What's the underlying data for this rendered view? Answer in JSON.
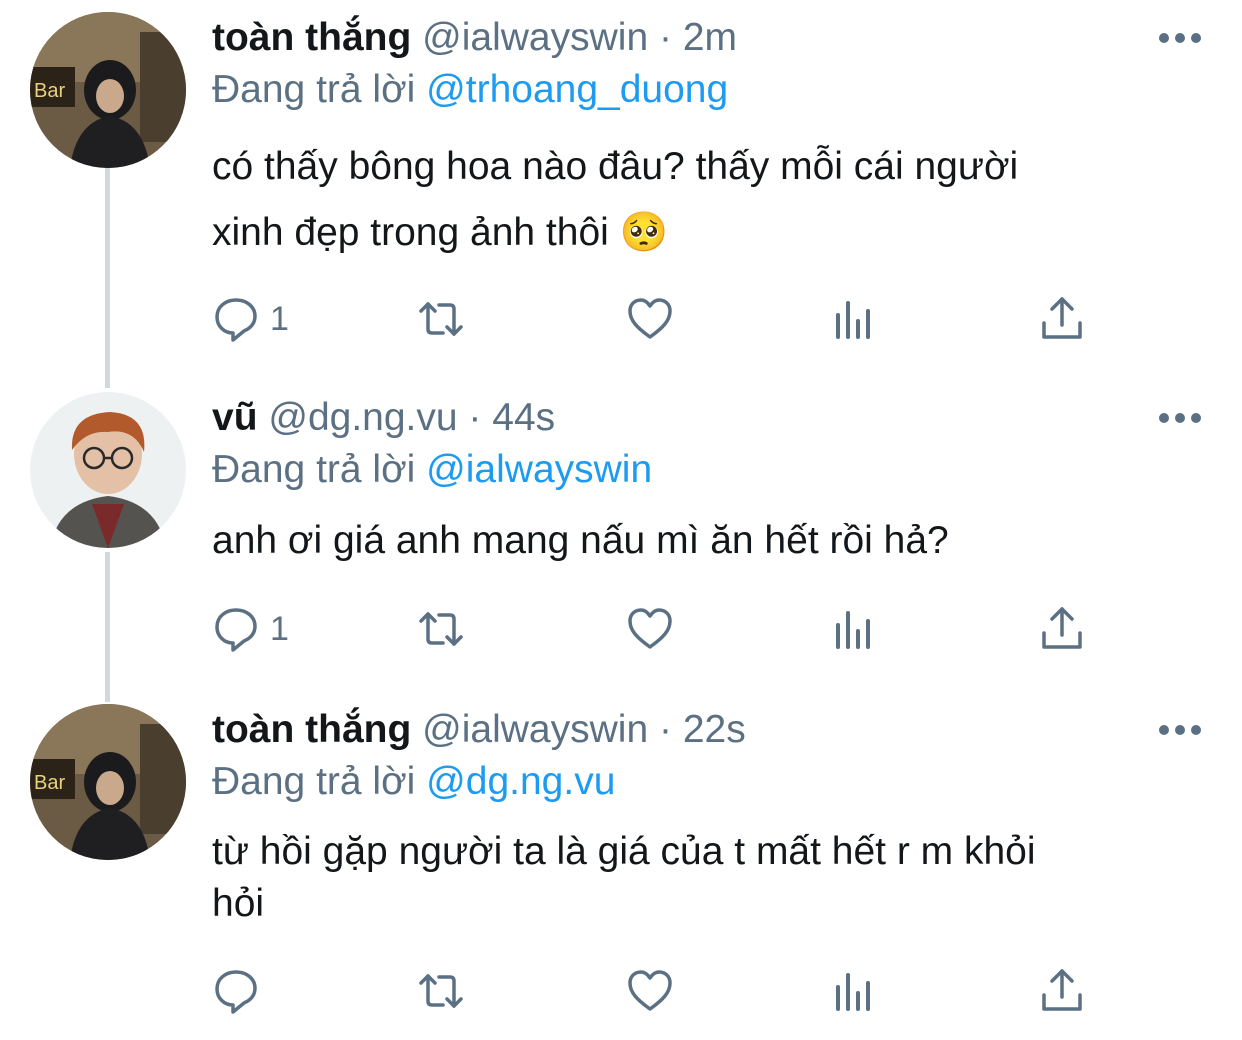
{
  "tweets": [
    {
      "name": "toàn thắng",
      "handle": "@ialwayswin",
      "separator": "·",
      "time": "2m",
      "reply_prefix": "Đang trả lời",
      "reply_to": "@trhoang_duong",
      "text_lines": [
        "có thấy bông hoa nào đâu? thấy mỗi cái người",
        "xinh đẹp trong ảnh thôi 🥺"
      ],
      "reply_count": "1",
      "avatar": "avatar-hooded"
    },
    {
      "name": "vũ",
      "handle": "@dg.ng.vu",
      "separator": "·",
      "time": "44s",
      "reply_prefix": "Đang trả lời",
      "reply_to": "@ialwayswin",
      "text_lines": [
        "anh ơi giá anh mang nấu mì ăn hết rồi hả?"
      ],
      "reply_count": "1",
      "avatar": "avatar-glasses"
    },
    {
      "name": "toàn thắng",
      "handle": "@ialwayswin",
      "separator": "·",
      "time": "22s",
      "reply_prefix": "Đang trả lời",
      "reply_to": "@dg.ng.vu",
      "text_lines": [
        "từ hồi gặp người ta là giá của t mất hết r m khỏi",
        "hỏi"
      ],
      "reply_count": "",
      "avatar": "avatar-hooded"
    }
  ],
  "icons": {
    "reply": "reply-icon",
    "retweet": "retweet-icon",
    "like": "heart-icon",
    "analytics": "analytics-icon",
    "share": "share-icon",
    "more": "more-icon"
  },
  "colors": {
    "text": "#14171a",
    "secondary": "#5b7083",
    "link": "#1d9bf0",
    "thread_line": "#cfd9de"
  }
}
